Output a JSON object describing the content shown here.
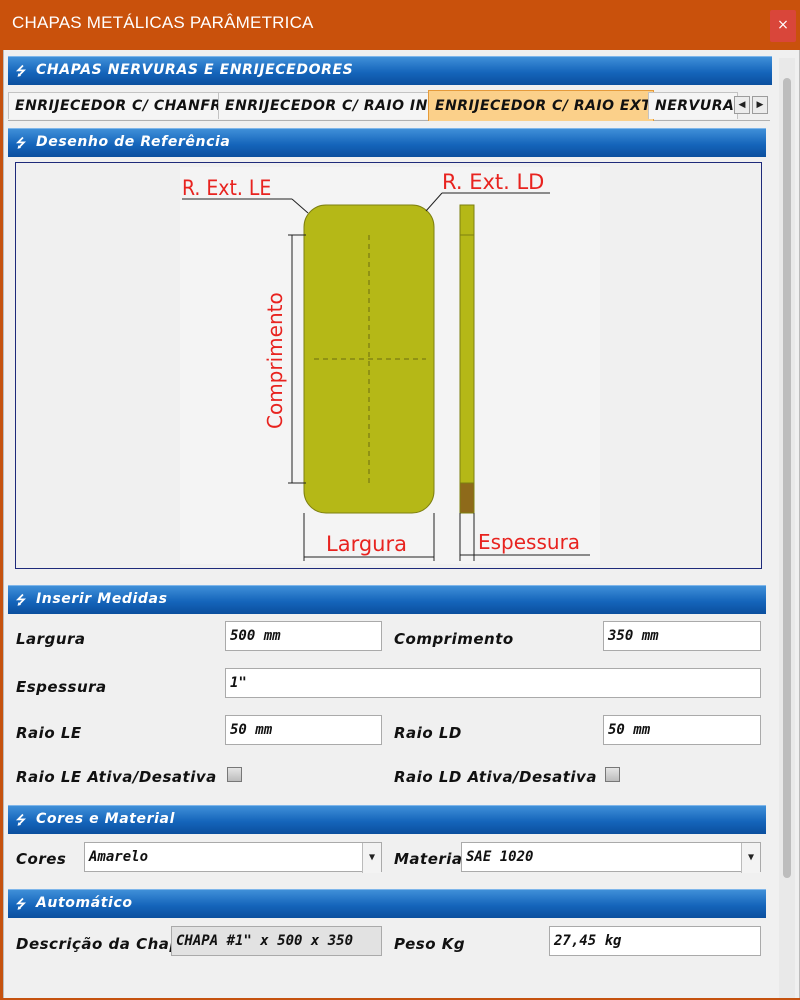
{
  "window": {
    "title": "CHAPAS METÁLICAS PARÂMETRICA",
    "close_glyph": "×"
  },
  "header_bar": "CHAPAS NERVURAS E ENRIJECEDORES",
  "tabs": [
    {
      "label": "ENRIJECEDOR C/ CHANFRO",
      "active": false
    },
    {
      "label": "ENRIJECEDOR C/ RAIO INT.",
      "active": false
    },
    {
      "label": "ENRIJECEDOR C/ RAIO EXT.",
      "active": true
    },
    {
      "label": "NERVURAS",
      "active": false
    }
  ],
  "sections": {
    "reference": "Desenho de Referência",
    "measures": "Inserir Medidas",
    "colors": "Cores e Material",
    "auto": "Automático"
  },
  "drawing": {
    "label_re_le": "R. Ext. LE",
    "label_re_ld": "R. Ext. LD",
    "label_comprimento": "Comprimento",
    "label_largura": "Largura",
    "label_espessura": "Espessura",
    "plate_color": "#b5b817",
    "label_color": "#e8231f"
  },
  "form": {
    "largura": {
      "label": "Largura",
      "value": "500 mm"
    },
    "comprimento": {
      "label": "Comprimento",
      "value": "350 mm"
    },
    "espessura": {
      "label": "Espessura",
      "value": "1\""
    },
    "raio_le": {
      "label": "Raio LE",
      "value": "50 mm"
    },
    "raio_ld": {
      "label": "Raio LD",
      "value": "50 mm"
    },
    "raio_le_toggle": {
      "label": "Raio LE Ativa/Desativa"
    },
    "raio_ld_toggle": {
      "label": "Raio LD Ativa/Desativa"
    },
    "cores": {
      "label": "Cores",
      "value": "Amarelo"
    },
    "material": {
      "label": "Material",
      "value": "SAE 1020"
    },
    "descricao": {
      "label": "Descrição da Chapa",
      "value": "CHAPA #1\" x 500 x 350"
    },
    "peso": {
      "label": "Peso Kg",
      "value": "27,45 kg"
    }
  },
  "colors": {
    "accent": "#1565bb",
    "titlebar": "#c9510c",
    "active_tab": "#fbd08a"
  }
}
